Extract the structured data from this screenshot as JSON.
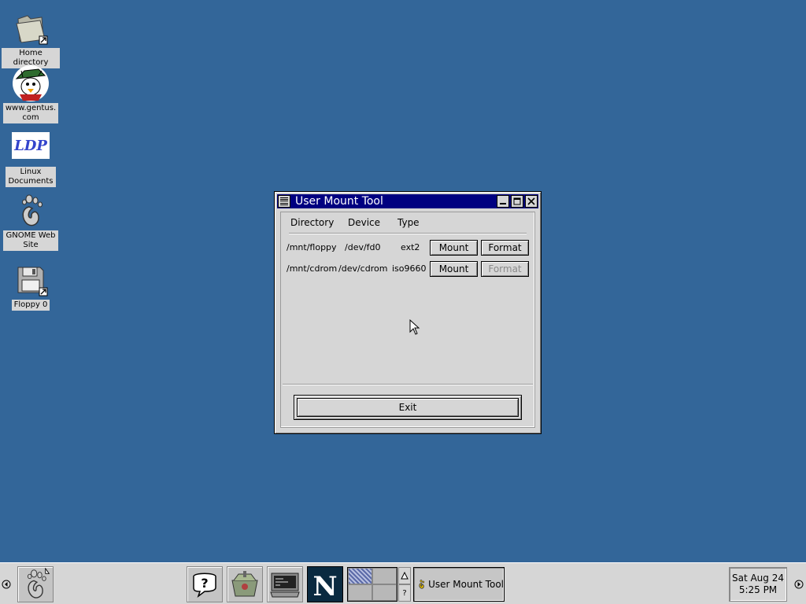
{
  "desktop": {
    "background_color": "#336699",
    "icons": [
      {
        "label": "Home directory",
        "icon": "folder-icon"
      },
      {
        "label": "www.gentus.\ncom",
        "icon": "gentus-logo-icon"
      },
      {
        "label": "Linux\nDocuments",
        "icon": "ldp-logo-icon",
        "logo_text": "LDP"
      },
      {
        "label": "GNOME Web\nSite",
        "icon": "gnome-foot-icon"
      },
      {
        "label": "Floppy 0",
        "icon": "floppy-icon"
      }
    ]
  },
  "window": {
    "title": "User Mount Tool",
    "title_color": "#000080",
    "headers": {
      "directory": "Directory",
      "device": "Device",
      "type": "Type"
    },
    "rows": [
      {
        "directory": "/mnt/floppy",
        "device": "/dev/fd0",
        "type": "ext2",
        "mount_label": "Mount",
        "format_label": "Format",
        "format_enabled": true
      },
      {
        "directory": "/mnt/cdrom",
        "device": "/dev/cdrom",
        "type": "iso9660",
        "mount_label": "Mount",
        "format_label": "Format",
        "format_enabled": false
      }
    ],
    "exit_label": "Exit"
  },
  "panel": {
    "launchers": [
      "gnome-menu-icon",
      "help-icon",
      "file-manager-icon",
      "terminal-icon",
      "netscape-icon"
    ],
    "netscape_letter": "N",
    "pager_help": "?",
    "task": {
      "label": "User Mount Tool",
      "icon": "gnome-foot-icon"
    },
    "clock": {
      "date": "Sat Aug 24",
      "time": "5:25 PM"
    }
  }
}
